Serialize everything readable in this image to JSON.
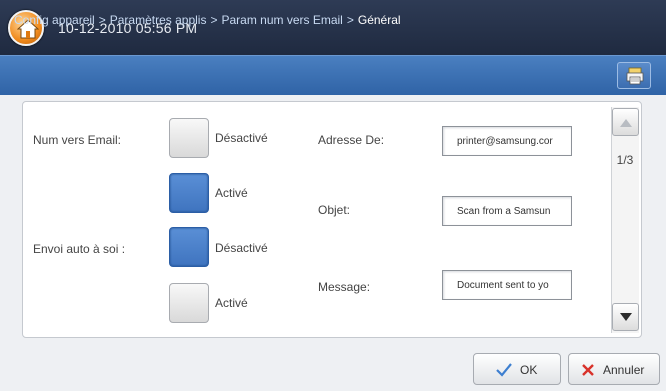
{
  "header": {
    "datetime": "10-12-2010 05:56 PM"
  },
  "breadcrumb": {
    "items": [
      "Config appareil",
      "Paramètres applis",
      "Param num vers Email",
      "Général"
    ],
    "separator": ">"
  },
  "settings": {
    "num_vers_email": {
      "label": "Num vers Email:",
      "off_label": "Désactivé",
      "on_label": "Activé",
      "selected": "Activé"
    },
    "envoi_auto": {
      "label": "Envoi auto à soi :",
      "off_label": "Désactivé",
      "on_label": "Activé",
      "selected": "Désactivé"
    },
    "adresse_de": {
      "label": "Adresse De:",
      "value": "printer@samsung.cor"
    },
    "objet": {
      "label": "Objet:",
      "value": "Scan from a Samsun"
    },
    "message": {
      "label": "Message:",
      "value": "Document sent to yo"
    }
  },
  "pagination": {
    "text": "1/3"
  },
  "footer": {
    "ok_label": "OK",
    "cancel_label": "Annuler"
  },
  "colors": {
    "selected_blue": "#4a80ca",
    "header": "#25314a",
    "breadcrumb_bar": "#3a6fb0"
  },
  "icons": [
    "home-icon",
    "job-status-icon",
    "arrow-up-icon",
    "arrow-down-icon",
    "checkmark-icon",
    "cross-icon"
  ]
}
